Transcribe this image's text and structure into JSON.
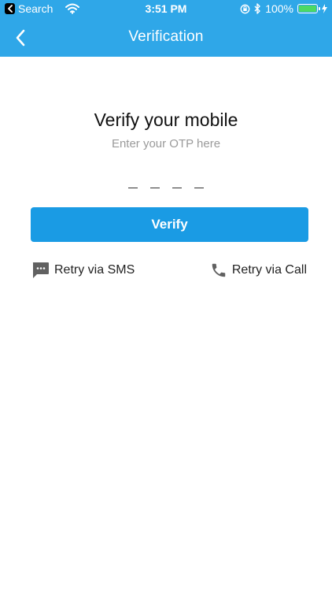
{
  "status_bar": {
    "back_app_label": "Search",
    "time": "3:51 PM",
    "battery_percent": "100%"
  },
  "nav": {
    "title": "Verification"
  },
  "content": {
    "title": "Verify your mobile",
    "subtitle": "Enter your OTP here",
    "otp_slot_count": 4,
    "verify_label": "Verify",
    "retry_sms_label": "Retry via SMS",
    "retry_call_label": "Retry via Call"
  },
  "colors": {
    "header": "#2fa7e8",
    "button": "#1a9be4",
    "subtitle": "#9a9a9a"
  },
  "icons": {
    "back": "chevron-left-icon",
    "sms": "message-bubble-icon",
    "call": "phone-icon"
  }
}
